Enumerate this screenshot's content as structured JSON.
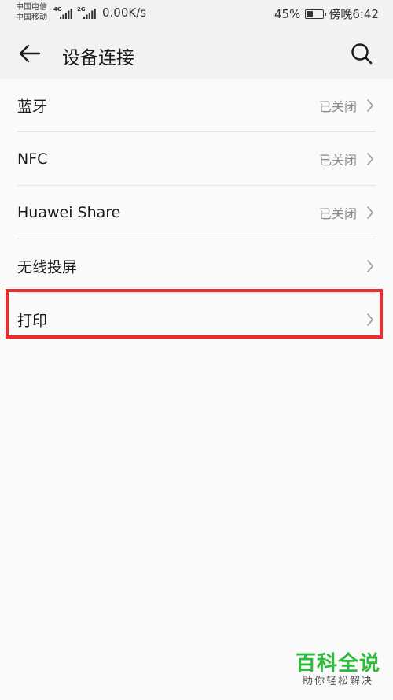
{
  "status_bar": {
    "carrier1": "中国电信",
    "carrier2": "中国移动",
    "net1": "4G",
    "net2": "2G",
    "speed": "0.00K/s",
    "battery_pct": "45%",
    "battery_level": 0.45,
    "time": "傍晚6:42"
  },
  "header": {
    "title": "设备连接",
    "back_icon": "arrow-left-icon",
    "search_icon": "search-icon"
  },
  "items": [
    {
      "label": "蓝牙",
      "value": "已关闭"
    },
    {
      "label": "NFC",
      "value": "已关闭"
    },
    {
      "label": "Huawei Share",
      "value": "已关闭"
    },
    {
      "label": "无线投屏",
      "value": ""
    },
    {
      "label": "打印",
      "value": ""
    }
  ],
  "watermark": {
    "title": "百科全说",
    "subtitle": "助你轻松解决"
  },
  "colors": {
    "highlight": "#f02d2d",
    "watermark": "#2bbd3a"
  }
}
